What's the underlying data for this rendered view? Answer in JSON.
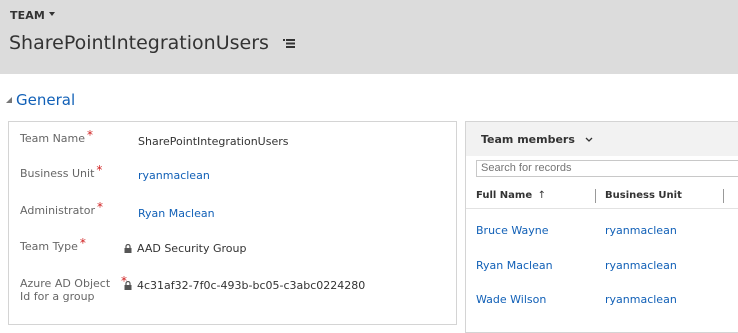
{
  "header": {
    "entity_type": "TEAM",
    "record_title": "SharePointIntegrationUsers"
  },
  "section": {
    "title": "General"
  },
  "fields": [
    {
      "label": "Team Name",
      "value": "SharePointIntegrationUsers",
      "required": "*",
      "locked": false,
      "link": false
    },
    {
      "label": "Business Unit",
      "value": "ryanmaclean",
      "required": "*",
      "locked": false,
      "link": true
    },
    {
      "label": "Administrator",
      "value": "Ryan Maclean",
      "required": "*",
      "locked": false,
      "link": true
    },
    {
      "label": "Team Type",
      "value": "AAD Security Group",
      "required": "*",
      "locked": true,
      "link": false
    },
    {
      "label": "Azure AD Object\nId for a group",
      "label_line1": "Azure AD Object",
      "label_line2": "Id for a group",
      "value": "4c31af32-7f0c-493b-bc05-c3abc0224280",
      "required": "*",
      "locked": true,
      "link": false
    }
  ],
  "subgrid": {
    "title": "Team members",
    "search_placeholder": "Search for records",
    "columns": [
      "Full Name",
      "Business Unit"
    ],
    "sort_indicator": "↑",
    "rows": [
      {
        "full_name": "Bruce Wayne",
        "business_unit": "ryanmaclean"
      },
      {
        "full_name": "Ryan Maclean",
        "business_unit": "ryanmaclean"
      },
      {
        "full_name": "Wade Wilson",
        "business_unit": "ryanmaclean"
      }
    ]
  },
  "colors": {
    "header_bg": "#dcdcdc",
    "link": "#1160b7",
    "required": "#d02020"
  },
  "icons": {
    "entity_dropdown": "caret-down-icon",
    "record_menu": "hamburger-menu-icon",
    "section_toggle": "collapse-triangle-icon",
    "lock": "lock-icon",
    "subgrid_view": "chevron-down-icon"
  }
}
